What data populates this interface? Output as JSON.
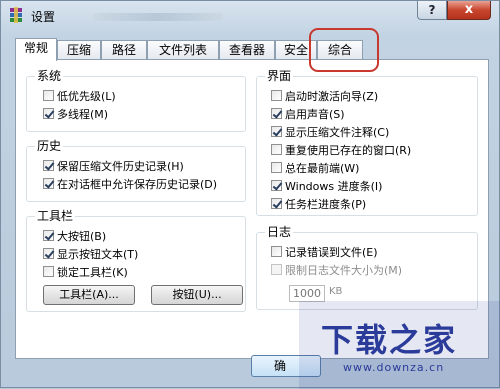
{
  "window": {
    "title": "设置"
  },
  "titlebar": {
    "help_label": "?",
    "close_label": "x"
  },
  "tabs": [
    {
      "label": "常规",
      "active": true
    },
    {
      "label": "压缩"
    },
    {
      "label": "路径"
    },
    {
      "label": "文件列表"
    },
    {
      "label": "查看器"
    },
    {
      "label": "安全"
    },
    {
      "label": "综合"
    }
  ],
  "groups": {
    "system": {
      "label": "系统",
      "items": [
        {
          "label": "低优先级(L)",
          "checked": false
        },
        {
          "label": "多线程(M)",
          "checked": true
        }
      ]
    },
    "history": {
      "label": "历史",
      "items": [
        {
          "label": "保留压缩文件历史记录(H)",
          "checked": true
        },
        {
          "label": "在对话框中允许保存历史记录(D)",
          "checked": true
        }
      ]
    },
    "toolbar": {
      "label": "工具栏",
      "items": [
        {
          "label": "大按钮(B)",
          "checked": true
        },
        {
          "label": "显示按钮文本(T)",
          "checked": true
        },
        {
          "label": "锁定工具栏(K)",
          "checked": false
        }
      ],
      "buttons": [
        "工具栏(A)...",
        "按钮(U)..."
      ]
    },
    "interface": {
      "label": "界面",
      "items": [
        {
          "label": "启动时激活向导(Z)",
          "checked": false
        },
        {
          "label": "启用声音(S)",
          "checked": true
        },
        {
          "label": "显示压缩文件注释(C)",
          "checked": true
        },
        {
          "label": "重复使用已存在的窗口(R)",
          "checked": false
        },
        {
          "label": "总在最前端(W)",
          "checked": false
        },
        {
          "label": "Windows 进度条(I)",
          "checked": true
        },
        {
          "label": "任务栏进度条(P)",
          "checked": true
        }
      ]
    },
    "log": {
      "label": "日志",
      "items": [
        {
          "label": "记录错误到文件(E)",
          "checked": false,
          "disabled": false
        },
        {
          "label": "限制日志文件大小为(M)",
          "checked": false,
          "disabled": true
        }
      ],
      "size_value": "1000",
      "size_unit": "KB"
    }
  },
  "footer": {
    "ok_label": "确"
  },
  "watermark": {
    "big": "下载之家",
    "small": "www.downza.cn"
  },
  "colors": {
    "highlight": "#c8382e",
    "close": "#c8452e",
    "watermark": "#2b3b9a"
  }
}
